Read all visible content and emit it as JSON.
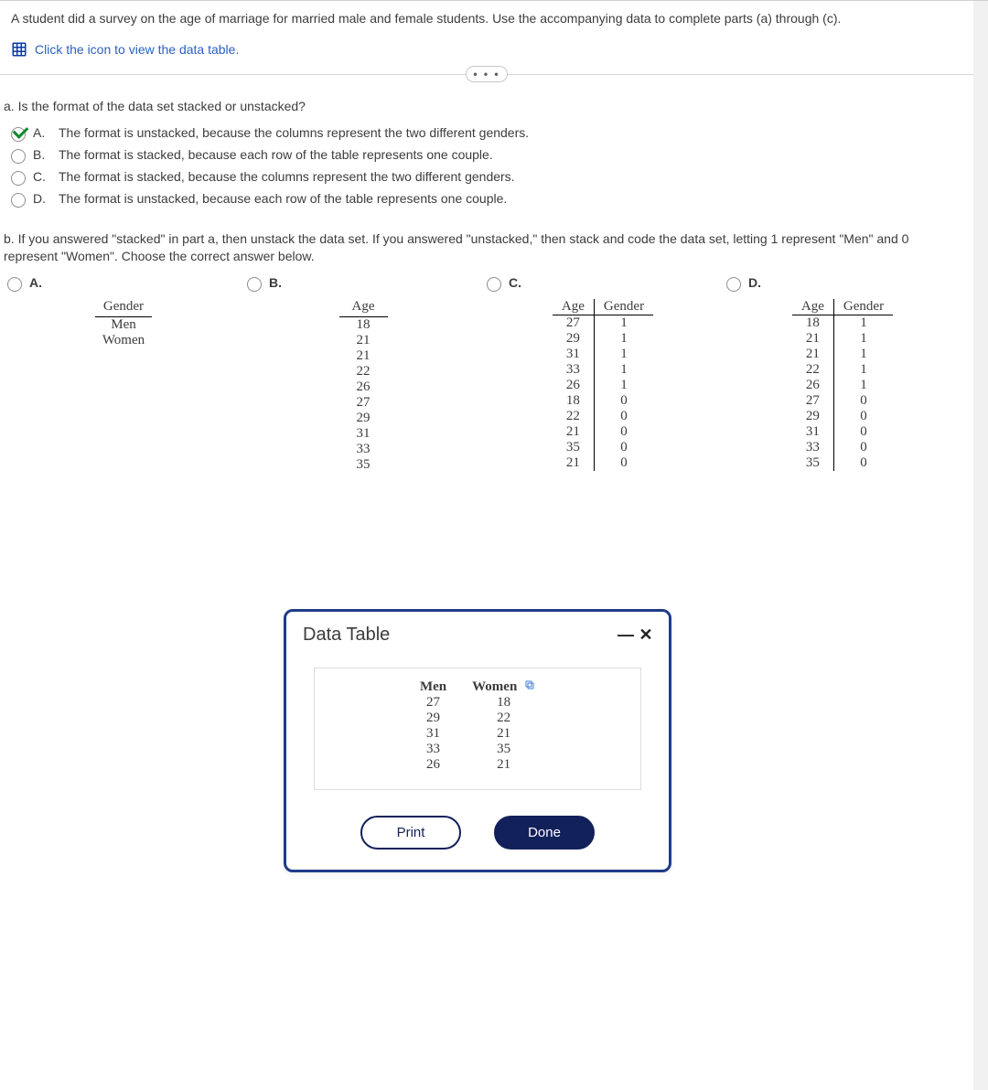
{
  "intro": "A student did a survey on the age of marriage for married male and female students. Use the accompanying data to complete parts (a) through (c).",
  "tableLink": "Click the icon to view the data table.",
  "dotsLabel": "• • •",
  "parta": {
    "question": "a. Is the format of the data set stacked or unstacked?",
    "choices": [
      {
        "letter": "A.",
        "text": "The format is unstacked, because the columns represent the two different genders.",
        "checked": true
      },
      {
        "letter": "B.",
        "text": "The format is stacked, because each row of the table represents one couple.",
        "checked": false
      },
      {
        "letter": "C.",
        "text": "The format is stacked, because the columns represent the two different genders.",
        "checked": false
      },
      {
        "letter": "D.",
        "text": "The format is unstacked, because each row of the table represents one couple.",
        "checked": false
      }
    ]
  },
  "partb": {
    "question": "b. If you answered \"stacked\" in part a, then unstack the data set. If you answered \"unstacked,\" then stack and code the data set, letting 1 represent \"Men\" and 0 represent \"Women\". Choose the correct answer below.",
    "labels": {
      "A": "A.",
      "B": "B.",
      "C": "C.",
      "D": "D."
    }
  },
  "optA": {
    "header": "Gender",
    "rows": [
      "Men",
      "Women"
    ]
  },
  "optB": {
    "header": "Age",
    "rows": [
      "18",
      "21",
      "21",
      "22",
      "26",
      "27",
      "29",
      "31",
      "33",
      "35"
    ]
  },
  "optC": {
    "h1": "Age",
    "h2": "Gender",
    "rows": [
      [
        "27",
        "1"
      ],
      [
        "29",
        "1"
      ],
      [
        "31",
        "1"
      ],
      [
        "33",
        "1"
      ],
      [
        "26",
        "1"
      ],
      [
        "18",
        "0"
      ],
      [
        "22",
        "0"
      ],
      [
        "21",
        "0"
      ],
      [
        "35",
        "0"
      ],
      [
        "21",
        "0"
      ]
    ]
  },
  "optD": {
    "h1": "Age",
    "h2": "Gender",
    "rows": [
      [
        "18",
        "1"
      ],
      [
        "21",
        "1"
      ],
      [
        "21",
        "1"
      ],
      [
        "22",
        "1"
      ],
      [
        "26",
        "1"
      ],
      [
        "27",
        "0"
      ],
      [
        "29",
        "0"
      ],
      [
        "31",
        "0"
      ],
      [
        "33",
        "0"
      ],
      [
        "35",
        "0"
      ]
    ]
  },
  "modal": {
    "title": "Data Table",
    "h1": "Men",
    "h2": "Women",
    "rows": [
      [
        "27",
        "18"
      ],
      [
        "29",
        "22"
      ],
      [
        "31",
        "21"
      ],
      [
        "33",
        "35"
      ],
      [
        "26",
        "21"
      ]
    ],
    "print": "Print",
    "done": "Done",
    "minimize": "—",
    "close": "✕"
  }
}
